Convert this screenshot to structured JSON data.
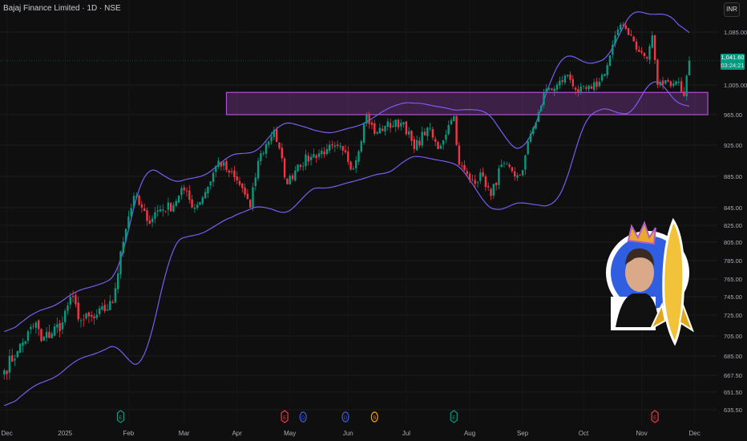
{
  "header": {
    "title": "Bajaj Finance Limited · 1D · NSE",
    "currency": "INR"
  },
  "last_price": {
    "value": "1,041.60",
    "countdown": "03:24:21"
  },
  "colors": {
    "up": "#089981",
    "down": "#f23645",
    "band": "#7a5cf0",
    "zone": "#b24fd6",
    "last": "#089981"
  },
  "events": [
    {
      "type": "E",
      "color": "#089981",
      "bar": 45
    },
    {
      "type": "E",
      "color": "#f23645",
      "bar": 107
    },
    {
      "type": "D",
      "color": "#3b5bdb",
      "bar": 114
    },
    {
      "type": "D",
      "color": "#3b5bdb",
      "bar": 130
    },
    {
      "type": "S",
      "color": "#f59f00",
      "bar": 141
    },
    {
      "type": "E",
      "color": "#089981",
      "bar": 171
    },
    {
      "type": "E",
      "color": "#f23645",
      "bar": 247
    }
  ],
  "chart_data": {
    "type": "candlestick",
    "title": "Bajaj Finance Limited · 1D · NSE",
    "y_ticks": [
      "1,085.00",
      "1,005.00",
      "965.00",
      "925.00",
      "885.00",
      "845.00",
      "825.00",
      "805.00",
      "785.00",
      "765.00",
      "745.00",
      "725.00",
      "705.00",
      "685.00",
      "667.50",
      "651.50",
      "635.50"
    ],
    "x_ticks": [
      {
        "label": "Dec",
        "bar": 2
      },
      {
        "label": "2025",
        "bar": 24
      },
      {
        "label": "Feb",
        "bar": 48
      },
      {
        "label": "Mar",
        "bar": 69
      },
      {
        "label": "Apr",
        "bar": 89
      },
      {
        "label": "May",
        "bar": 109
      },
      {
        "label": "Jun",
        "bar": 131
      },
      {
        "label": "Jul",
        "bar": 153
      },
      {
        "label": "Aug",
        "bar": 177
      },
      {
        "label": "Sep",
        "bar": 197
      },
      {
        "label": "Oct",
        "bar": 220
      },
      {
        "label": "Nov",
        "bar": 242
      },
      {
        "label": "Dec",
        "bar": 262
      }
    ],
    "close_anchors": [
      [
        1,
        672
      ],
      [
        6,
        690
      ],
      [
        13,
        718
      ],
      [
        15,
        700
      ],
      [
        23,
        718
      ],
      [
        26,
        745
      ],
      [
        30,
        720
      ],
      [
        35,
        722
      ],
      [
        42,
        738
      ],
      [
        45,
        795
      ],
      [
        48,
        835
      ],
      [
        50,
        860
      ],
      [
        55,
        830
      ],
      [
        59,
        842
      ],
      [
        65,
        848
      ],
      [
        68,
        870
      ],
      [
        73,
        845
      ],
      [
        77,
        865
      ],
      [
        82,
        905
      ],
      [
        86,
        890
      ],
      [
        91,
        870
      ],
      [
        94,
        845
      ],
      [
        97,
        905
      ],
      [
        103,
        945
      ],
      [
        108,
        875
      ],
      [
        112,
        900
      ],
      [
        117,
        910
      ],
      [
        123,
        920
      ],
      [
        129,
        918
      ],
      [
        133,
        895
      ],
      [
        138,
        965
      ],
      [
        141,
        940
      ],
      [
        145,
        950
      ],
      [
        152,
        955
      ],
      [
        156,
        920
      ],
      [
        161,
        948
      ],
      [
        165,
        920
      ],
      [
        170,
        958
      ],
      [
        171,
        963
      ],
      [
        173,
        900
      ],
      [
        177,
        880
      ],
      [
        182,
        885
      ],
      [
        185,
        860
      ],
      [
        189,
        900
      ],
      [
        194,
        885
      ],
      [
        197,
        893
      ],
      [
        200,
        940
      ],
      [
        203,
        968
      ],
      [
        206,
        1000
      ],
      [
        209,
        1000
      ],
      [
        214,
        1020
      ],
      [
        218,
        995
      ],
      [
        223,
        1000
      ],
      [
        226,
        1010
      ],
      [
        229,
        1035
      ],
      [
        232,
        1080
      ],
      [
        235,
        1095
      ],
      [
        238,
        1080
      ],
      [
        241,
        1055
      ],
      [
        244,
        1045
      ],
      [
        246,
        1080
      ],
      [
        248,
        1005
      ],
      [
        252,
        1010
      ],
      [
        256,
        1010
      ],
      [
        258,
        990
      ],
      [
        260,
        1041.6
      ]
    ],
    "last_close": 1041.6,
    "zone": {
      "low": 965,
      "high": 995,
      "from_bar": 85,
      "to_bar": 267
    },
    "indicator": "Bollinger-style envelope"
  }
}
